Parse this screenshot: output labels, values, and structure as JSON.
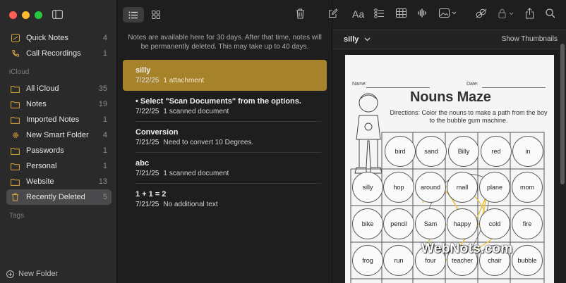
{
  "sidebar": {
    "top_items": [
      {
        "label": "Quick Notes",
        "count": "4",
        "icon": "quick-notes-icon"
      },
      {
        "label": "Call Recordings",
        "count": "1",
        "icon": "phone-icon"
      }
    ],
    "section_icloud": "iCloud",
    "icloud_items": [
      {
        "label": "All iCloud",
        "count": "35"
      },
      {
        "label": "Notes",
        "count": "19"
      },
      {
        "label": "Imported Notes",
        "count": "1"
      },
      {
        "label": "New Smart Folder",
        "count": "4"
      },
      {
        "label": "Passwords",
        "count": "1"
      },
      {
        "label": "Personal",
        "count": "1"
      },
      {
        "label": "Website",
        "count": "13"
      },
      {
        "label": "Recently Deleted",
        "count": "5"
      }
    ],
    "section_tags": "Tags",
    "new_folder": "New Folder"
  },
  "list": {
    "info": "Notes are available here for 30 days. After that time, notes will be permanently deleted. This may take up to 40 days.",
    "notes": [
      {
        "title": "silly",
        "date": "7/22/25",
        "meta": "1 attachment"
      },
      {
        "title": "• Select \"Scan Documents\" from the options.",
        "date": "7/22/25",
        "meta": "1 scanned document"
      },
      {
        "title": "Conversion",
        "date": "7/21/25",
        "meta": "Need to convert 10 Degrees."
      },
      {
        "title": "abc",
        "date": "7/21/25",
        "meta": "1 scanned document"
      },
      {
        "title": "1 + 1  = 2",
        "date": "7/21/25",
        "meta": "No additional text"
      }
    ]
  },
  "detail": {
    "note_name": "silly",
    "show_thumbnails": "Show Thumbnails",
    "format_label": "Aa"
  },
  "worksheet": {
    "name_label": "Name:",
    "date_label": "Date:",
    "title": "Nouns Maze",
    "directions": "Directions: Color the nouns to make a path from the boy to the bubble gum machine.",
    "rows": [
      [
        "bird",
        "sand",
        "Billy",
        "red",
        "in"
      ],
      [
        "silly",
        "hop",
        "around",
        "mall",
        "plane",
        "mom"
      ],
      [
        "bike",
        "pencil",
        "Sam",
        "happy",
        "cold",
        "fire"
      ],
      [
        "frog",
        "run",
        "four",
        "teacher",
        "chair",
        "bubble"
      ]
    ]
  },
  "watermark": "WebNots.com",
  "colors": {
    "accent": "#a6822a",
    "sidebar_bg": "#2a2a2b",
    "folder_icon": "#d9a53b"
  }
}
